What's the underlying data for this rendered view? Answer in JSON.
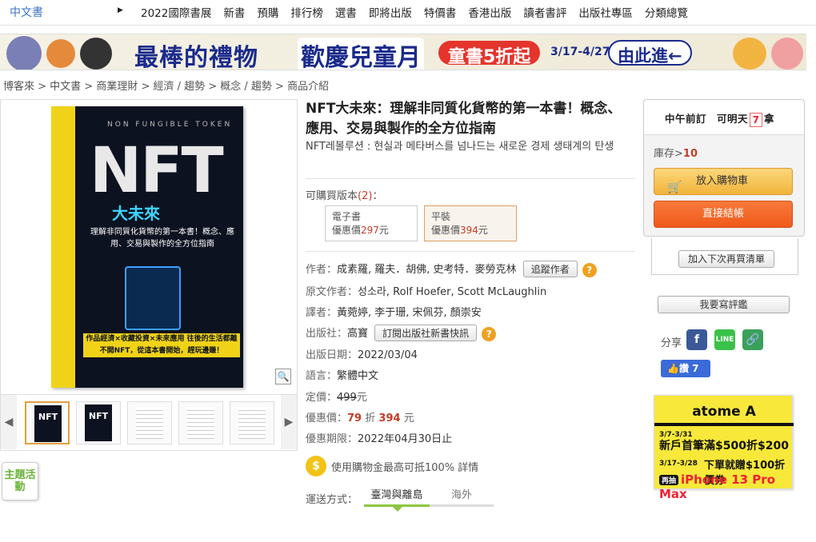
{
  "topnav": {
    "category": "中文書",
    "links": [
      "2022國際書展",
      "新書",
      "預購",
      "排行榜",
      "選書",
      "即將出版",
      "特價書",
      "香港出版",
      "讀者書評",
      "出版社專區",
      "分類總覽"
    ]
  },
  "banner": {
    "t1": "最棒的禮物",
    "t2": "歡慶兒童月",
    "t3": "童書5折起",
    "t4": "3/17-4/27",
    "t5": "由此進←"
  },
  "breadcrumb": "博客來 > 中文書 > 商業理財 > 經濟 / 趨勢 > 概念 / 趨勢 > 商品介紹",
  "cover": {
    "top_text": "NON FUNGIBLE TOKEN",
    "title": "NFT",
    "subtitle": "大未來",
    "tagline": "理解非同質化貨幣的第一本書！概念、應用、交易與製作的全方位指南",
    "banner_text": "作品經濟×收藏投資×未來應用 往後的生活都離不開NFT，從這本書開始，趕玩邊賺！",
    "thumb_label": "NFT"
  },
  "product": {
    "title": "NFT大未來：理解非同質化貨幣的第一本書！概念、應用、交易與製作的全方位指南",
    "original_title": "NFT레볼루션 : 현실과 메타버스를 넘나드는 새로운 경제 생태계의 탄생",
    "available_label": "可購買版本",
    "available_count": "(2)",
    "available_colon": "：",
    "versions": [
      {
        "name": "電子書",
        "price_label": "優惠價",
        "price": "297",
        "unit": "元"
      },
      {
        "name": "平裝",
        "price_label": "優惠價",
        "price": "394",
        "unit": "元"
      }
    ],
    "author_label": "作者：",
    "author": "成素羅, 羅夫．胡佛, 史考特．麥勞克林",
    "follow_author": "追蹤作者",
    "orig_author_label": "原文作者：",
    "orig_author": "성소라, Rolf Hoefer, Scott McLaughlin",
    "translator_label": "譯者：",
    "translator": "黃菀婷, 李于珊, 宋佩芬, 顏崇安",
    "publisher_label": "出版社：",
    "publisher": "高寶",
    "subscribe_publisher": "訂閱出版社新書快訊",
    "pubdate_label": "出版日期：",
    "pubdate": "2022/03/04",
    "lang_label": "語言：",
    "lang": "繁體中文",
    "list_price_label": "定價：",
    "list_price": "499",
    "price_unit": "元",
    "sale_label": "優惠價：",
    "discount": "79",
    "discount_unit": "折",
    "sale_price": "394",
    "sale_until_label": "優惠期限：",
    "sale_until": "2022年04月30日止",
    "coin_text": "使用購物金最高可抵100% 詳情",
    "ship_label": "運送方式：",
    "ship_tabs": [
      "臺灣與離島",
      "海外"
    ]
  },
  "theme_button": "主題活動",
  "buy": {
    "head_a": "中午前訂　可明天",
    "head_b": "拿",
    "seven": "7",
    "stock_label": "庫存>",
    "stock": "10",
    "cart": "放入購物車",
    "checkout": "直接結帳",
    "wishlist": "加入下次再買清單",
    "review": "我要寫評鑑",
    "share_label": "分享",
    "like": "讚 7"
  },
  "atome": {
    "logo": "atome A",
    "line1_date": "3/7-3/31",
    "line1": "新戶首筆滿$500折$200",
    "line2_date": "3/17-3/28",
    "line2": "下單就贈$100折價券",
    "tag": "再抽",
    "line3": "iPhone 13 Pro Max"
  },
  "colors": {
    "accent_red": "#c43c25",
    "link_blue": "#3a77bf",
    "green": "#8cc63e",
    "orange": "#ef5a1a"
  }
}
